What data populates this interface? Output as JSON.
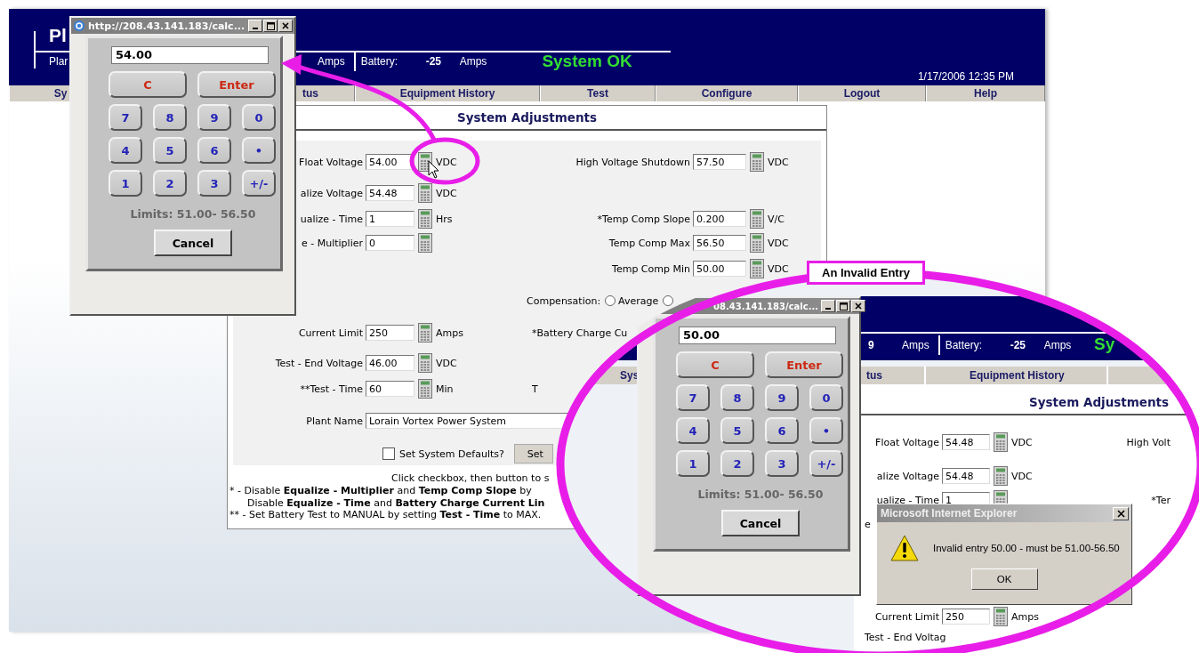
{
  "page": {
    "header": {
      "logo": "Pl",
      "subtitle": "Plar",
      "readings": [
        {
          "unit": "Amps"
        },
        {
          "label": "Battery:",
          "value": "-25",
          "unit": "Amps"
        }
      ],
      "status": "System OK",
      "datetime": "1/17/2006 12:35 PM"
    },
    "nav": [
      {
        "label": "Sy"
      },
      {
        "label": "tus"
      },
      {
        "label": "Equipment History"
      },
      {
        "label": "Test"
      },
      {
        "label": "Configure"
      },
      {
        "label": "Logout"
      },
      {
        "label": "Help"
      }
    ],
    "form": {
      "title": "System Adjustments",
      "rows": [
        {
          "left": {
            "kind": "number",
            "label": "Float Voltage",
            "value": "54.00",
            "unit": "VDC"
          },
          "right": {
            "kind": "number",
            "label": "High Voltage Shutdown",
            "value": "57.50",
            "unit": "VDC"
          }
        },
        {
          "left": {
            "kind": "number",
            "label": "alize Voltage",
            "value": "54.48",
            "unit": "VDC"
          }
        },
        {
          "left": {
            "kind": "number",
            "label": "ualize - Time",
            "value": "1",
            "unit": "Hrs"
          },
          "right": {
            "kind": "number",
            "label": "*Temp Comp Slope",
            "value": "0.200",
            "unit": "V/C"
          }
        },
        {
          "left": {
            "kind": "number",
            "label": "e - Multiplier",
            "value": "0"
          },
          "right": {
            "kind": "number",
            "label": "Temp Comp Max",
            "value": "56.50",
            "unit": "VDC"
          }
        },
        {
          "right": {
            "kind": "number",
            "label": "Temp Comp Min",
            "value": "50.00",
            "unit": "VDC"
          }
        },
        {
          "right": {
            "kind": "radio",
            "label": "Compensation:",
            "options": [
              {
                "label": "Average",
                "selected": false
              },
              {
                "selected": false
              }
            ]
          }
        },
        {
          "left": {
            "kind": "number",
            "label": "Current Limit",
            "value": "250",
            "unit": "Amps"
          },
          "right": {
            "kind": "caption",
            "label": "*Battery Charge Cu"
          }
        },
        {
          "left": {
            "kind": "number",
            "label": "Test - End Voltage",
            "value": "46.00",
            "unit": "VDC"
          }
        },
        {
          "left": {
            "kind": "number",
            "label": "**Test - Time",
            "value": "60",
            "unit": "Min"
          },
          "right": {
            "kind": "caption",
            "label": "T"
          }
        },
        {
          "left": {
            "kind": "text",
            "label": "Plant Name",
            "value": "Lorain Vortex Power System"
          }
        },
        {
          "left": {
            "kind": "checkbox",
            "label": "Set System Defaults?",
            "checked": false,
            "button": "Set"
          }
        }
      ],
      "hint": "Click checkbox, then button to s",
      "notes": [
        {
          "lines": [
            "* - Disable **Equalize - Multiplier** and **Temp Comp Slope** by",
            "Disable **Equalize - Time** and **Battery Charge Current Lin**"
          ]
        },
        {
          "lines": [
            "** - Set Battery Test to MANUAL by setting **Test - Time** to MAX."
          ]
        }
      ]
    }
  },
  "calculator": {
    "title": "http://208.43.141.183/calc...",
    "display": "54.00",
    "keys": [
      {
        "label": "C",
        "kind": "action"
      },
      {
        "label": "Enter",
        "kind": "action"
      },
      {
        "label": "7",
        "kind": "digit"
      },
      {
        "label": "8",
        "kind": "digit"
      },
      {
        "label": "9",
        "kind": "digit"
      },
      {
        "label": "0",
        "kind": "digit"
      },
      {
        "label": "4",
        "kind": "digit"
      },
      {
        "label": "5",
        "kind": "digit"
      },
      {
        "label": "6",
        "kind": "digit"
      },
      {
        "label": "•",
        "kind": "digit"
      },
      {
        "label": "1",
        "kind": "digit"
      },
      {
        "label": "2",
        "kind": "digit"
      },
      {
        "label": "3",
        "kind": "digit"
      },
      {
        "label": "+/-",
        "kind": "digit"
      }
    ],
    "limits": "Limits: 51.00- 56.50",
    "cancel": "Cancel"
  },
  "callout": {
    "label": "An Invalid Entry",
    "header": {
      "readings": [
        {
          "value": "9",
          "unit": "Amps"
        },
        {
          "label": "Battery:",
          "value": "-25",
          "unit": "Amps"
        }
      ],
      "status": "Sy"
    },
    "nav": [
      {
        "label": "Sys"
      },
      {
        "label": "tus"
      },
      {
        "label": "Equipment History"
      }
    ],
    "title": "System Adjustments",
    "rows": [
      {
        "left": {
          "kind": "number",
          "label": "Float Voltage",
          "value": "54.48",
          "unit": "VDC"
        },
        "right": {
          "kind": "caption",
          "label": "High Volt"
        }
      },
      {
        "left": {
          "kind": "number",
          "label": "alize Voltage",
          "value": "54.48",
          "unit": "VDC"
        }
      },
      {
        "left": {
          "kind": "number",
          "label": "ualize - Time",
          "value": "1"
        },
        "right": {
          "kind": "caption",
          "label": "*Ter"
        }
      },
      {
        "left": {
          "kind": "caption",
          "label": "e"
        }
      },
      {
        "left": {
          "kind": "number",
          "label": "Current Limit",
          "value": "250",
          "unit": "Amps"
        }
      },
      {
        "left": {
          "kind": "caption",
          "label": "Test - End Voltag"
        }
      }
    ],
    "calculator": {
      "title": "08.43.141.183/calc...",
      "display": "50.00",
      "keys": [
        {
          "label": "C",
          "kind": "action"
        },
        {
          "label": "Enter",
          "kind": "action"
        },
        {
          "label": "7",
          "kind": "digit"
        },
        {
          "label": "8",
          "kind": "digit"
        },
        {
          "label": "9",
          "kind": "digit"
        },
        {
          "label": "0",
          "kind": "digit"
        },
        {
          "label": "4",
          "kind": "digit"
        },
        {
          "label": "5",
          "kind": "digit"
        },
        {
          "label": "6",
          "kind": "digit"
        },
        {
          "label": "•",
          "kind": "digit"
        },
        {
          "label": "1",
          "kind": "digit"
        },
        {
          "label": "2",
          "kind": "digit"
        },
        {
          "label": "3",
          "kind": "digit"
        },
        {
          "label": "+/-",
          "kind": "digit"
        }
      ],
      "limits": "Limits: 51.00- 56.50",
      "cancel": "Cancel"
    },
    "alert": {
      "title": "Microsoft Internet Explorer",
      "message": "Invalid entry 50.00 - must be 51.00-56.50",
      "button": "OK"
    }
  }
}
